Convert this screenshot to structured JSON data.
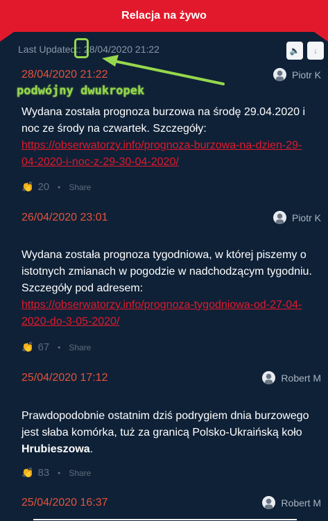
{
  "header": {
    "title": "Relacja na żywo"
  },
  "status": {
    "last_updated": "Last Updated:: 28/04/2020 21:22"
  },
  "controls": {
    "sound_icon": "speaker-icon",
    "sort_icon": "arrow-down-icon"
  },
  "posts": [
    {
      "time": "28/04/2020 21:22",
      "author": "Piotr K",
      "text_before": "Wydana została prognoza burzowa na środę 29.04.2020 i noc ze środy na czwartek. Szczegóły: ",
      "link": "https://obserwatorzy.info/prognoza-burzowa-na-dzien-29-04-2020-i-noc-z-29-30-04-2020/",
      "claps": "20",
      "share": "Share"
    },
    {
      "time": "26/04/2020 23:01",
      "author": "Piotr K",
      "text_before": "Wydana została prognoza tygodniowa, w której piszemy o istotnych zmianach w pogodzie w nadchodzącym tygodniu. Szczegóły pod adresem: ",
      "link": "https://obserwatorzy.info/prognoza-tygodniowa-od-27-04-2020-do-3-05-2020/",
      "claps": "67",
      "share": "Share"
    },
    {
      "time": "25/04/2020 17:12",
      "author": "Robert M",
      "text_before": "Prawdopodobnie ostatnim dziś podrygiem dnia burzowego jest słaba komórka, tuż za granicą Polsko-Ukraińską koło ",
      "bold": "Hrubieszowa",
      "text_after": ".",
      "claps": "83",
      "share": "Share"
    },
    {
      "time": "25/04/2020 16:37",
      "author": "Robert M"
    }
  ],
  "annotation": {
    "label": "podwójny dwukropek"
  },
  "colors": {
    "header_bg": "#e2192c",
    "page_bg": "#0f2137",
    "time": "#e5533a",
    "link": "#e2192c",
    "annotation": "#96d74d"
  }
}
